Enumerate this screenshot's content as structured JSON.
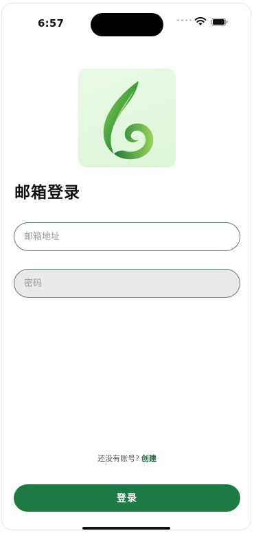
{
  "status_bar": {
    "time": "6:57",
    "icons": [
      "signal-dots-icon",
      "wifi-icon",
      "battery-icon"
    ]
  },
  "logo": {
    "icon": "leaf-swirl-logo",
    "colors": {
      "card_background": "#dcf5d6",
      "leaf_dark": "#1e7a3c",
      "leaf_light": "#7cc242"
    }
  },
  "page": {
    "title": "邮箱登录"
  },
  "form": {
    "email": {
      "placeholder": "邮箱地址",
      "value": ""
    },
    "password": {
      "placeholder": "密码",
      "value": ""
    }
  },
  "signup": {
    "prompt": "还没有账号?",
    "link_label": "创建"
  },
  "actions": {
    "login_label": "登录"
  },
  "theme": {
    "accent": "#1d7a45",
    "input_border": "#5f7d6a"
  }
}
